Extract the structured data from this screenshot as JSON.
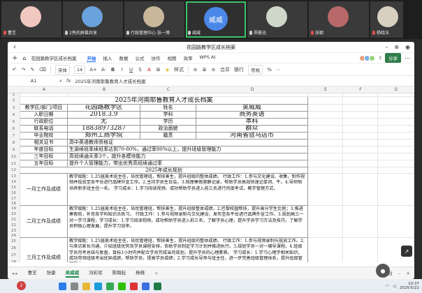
{
  "participants": [
    {
      "name": "曹艺",
      "color": "#f0c8c0",
      "mic": "off"
    },
    {
      "name": "2秀的屏幕共享",
      "color": "#6aa2dd",
      "mic": "on"
    },
    {
      "name": "行政管理中心 张一博",
      "color": "#c9b79a",
      "mic": "on"
    },
    {
      "name": "威威",
      "color": "#4a87e8",
      "mic": "on",
      "initials": "威威"
    },
    {
      "name": "郑豪迅",
      "color": "#cfd8c8",
      "mic": "on"
    },
    {
      "name": "张朝",
      "color": "#b86868",
      "mic": "off"
    },
    {
      "name": "杨晓玉",
      "color": "#d8cfc0",
      "mic": "off"
    }
  ],
  "window": {
    "title": "花园路教学区成长档案"
  },
  "menubar": {
    "doc_name": "花园路教学区成长档案",
    "items": [
      "开始",
      "插入",
      "数据",
      "公式",
      "协作",
      "视图",
      "效率",
      "WPS AI"
    ],
    "active": "开始",
    "collab_count": "3",
    "share_label": "分享"
  },
  "toolbar": {
    "font": "宋体",
    "size": "14",
    "merge": "合并",
    "wrap": "换行",
    "format": "常规",
    "style": "样式",
    "fill": "填充"
  },
  "formula": {
    "cell_ref": "A1",
    "fx": "fx",
    "value": "2025年河南耶鲁教育人才成长档案"
  },
  "columns": [
    "A",
    "B",
    "C",
    "D",
    "E",
    "F",
    "G"
  ],
  "sheet": {
    "title": "2025年河南耶鲁教育人才成长档案",
    "rows": [
      {
        "num": "3",
        "a": "教学区/部门/项目",
        "b": "花园路教学区",
        "c": "姓名",
        "d": "吴威威"
      },
      {
        "num": "4",
        "a": "入职日期",
        "b": "2018.3.9",
        "c": "学科",
        "d": "商务英语"
      },
      {
        "num": "5",
        "a": "行政职位",
        "b": "无",
        "c": "学历",
        "d": "本科"
      },
      {
        "num": "6",
        "a": "联系电话",
        "b": "18838973287",
        "c": "政治面貌",
        "d": "群众"
      },
      {
        "num": "7",
        "a": "毕业院校",
        "b": "郑州工商学院",
        "c": "籍贯",
        "d": "河南省驻马店市"
      },
      {
        "num": "8",
        "a": "相关证书",
        "span": "高中英语教师资格证"
      },
      {
        "num": "9",
        "a": "年度目标",
        "span": "生源续班率续班率达到70-80%，通过率80%以上，提升班级管理能力"
      },
      {
        "num": "10",
        "a": "三年目标",
        "span": "高班续通天率3个，提升各模块能力"
      },
      {
        "num": "11",
        "a": "五年目标",
        "span": "提升个人管理能力，带出优秀高班续通过率"
      }
    ],
    "section_title": "2025年成长规划",
    "plans": [
      {
        "label": "一月工作及成绩",
        "text": "教学赋能：1.25届美术班主任，培优管理班，帮扶差生，提升班级的整体成绩。  行政工作：1.参与文化建设、收集，制作视频并投放至各平台进行品牌外宣工作。2.主持学员生日会。3.梳理寒假营静记录，帮助学员高效快速记单词、牛。4.导师制 培养新手班主任一名。  学习成长：1.学习阅读视频、成功帮助学员进入前三名进行月度考试，教学管理方式。"
      },
      {
        "label": "二月工作及成绩",
        "text": "教学赋能：1.25届美术班主任，培优管理班，帮扶差生，提升班级整体成绩。2.巴黎校园帮扶，提升高分学生比例；3.推进寒假前，补充各学科知识点练习。  行政工作：1.参与视频录制与文化建设，发布至各平台进行品牌外宣工作。3.规划高三一对一学习课程，学习成长：1.学习阅读视频，成功帮助学员进入前三名，了解学员心理，提升学员学习方法及技巧，了解学员积极心理发展，提升学习效率。"
      },
      {
        "label": "三月工作及成绩",
        "text": "教学赋能：1.25届美术班主任，培优管理班，帮扶差生，提升班级的整体成绩。  行政工作：1.参与视频录制与投放工作。2.与来访家长沟通，介绍班级优势及学员课程安排，协助学员制定学习计划并推进执行。3.规划学员一对一辅导课程。4.班级学员月考总结与复盘，目标1小时内并配合学员完成当月规划，提升学员的心理素质。  学习成长：1.学习心理学相关知识，成功带领班级考出优异成绩，帮助学员，提高学员成绩；2.学习成长导师与班主任，进一步完善班级管理体系，提升班级管理能力。"
      }
    ]
  },
  "tabs": {
    "items": [
      "曹艺",
      "张豪",
      "吴威威",
      "冯彩欢",
      "陈翰耘",
      "杨晓"
    ],
    "active": "吴威威"
  },
  "taskbar": {
    "badge": "2",
    "date": "2025/5/22",
    "time": "10:37"
  }
}
